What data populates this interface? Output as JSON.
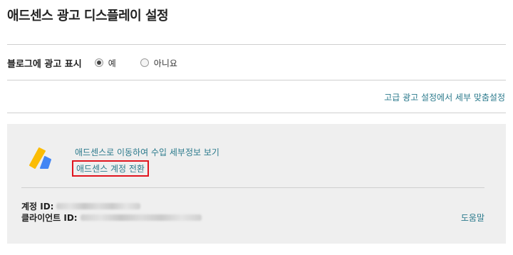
{
  "page": {
    "title": "애드센스 광고 디스플레이 설정"
  },
  "display_setting": {
    "label": "블로그에 광고 표시",
    "options": [
      {
        "label": "예",
        "selected": true
      },
      {
        "label": "아니요",
        "selected": false
      }
    ]
  },
  "advanced_link": "고급 광고 설정에서 세부 맞춤설정",
  "adsense_panel": {
    "logo_icon": "google-adsense-logo",
    "details_link": "애드센스로 이동하여 수입 세부정보 보기",
    "switch_account_link": "애드센스 계정 전환",
    "account_id_label": "계정 ID:",
    "client_id_label": "클라이언트 ID:",
    "help_link": "도움말"
  },
  "colors": {
    "link": "#2b7a8c",
    "highlight_border": "#e0151f",
    "panel_bg": "#efefef",
    "logo_yellow": "#fbbc04",
    "logo_blue": "#4285f4"
  }
}
